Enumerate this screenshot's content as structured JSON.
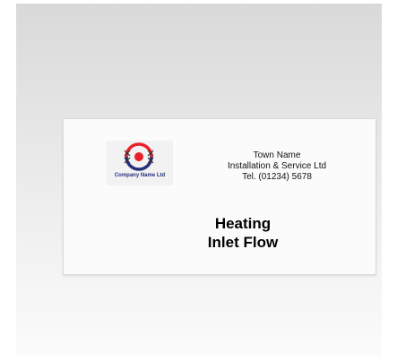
{
  "label": {
    "logo_company_name": "Company Name Ltd",
    "contact": {
      "town": "Town Name",
      "service": "Installation & Service Ltd",
      "phone": "Tel. (01234) 5678"
    },
    "title_line1": "Heating",
    "title_line2": "Inlet Flow"
  },
  "colors": {
    "logo_red": "#e8202a",
    "logo_navy": "#26307a"
  }
}
